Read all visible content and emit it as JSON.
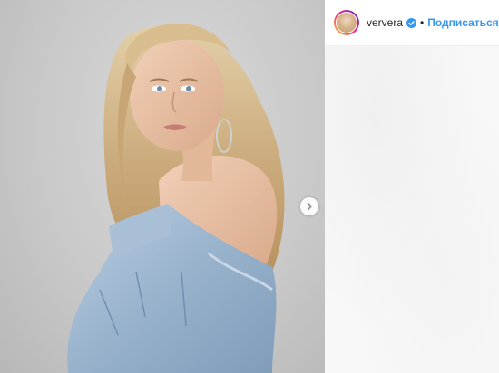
{
  "post": {
    "photo_alt": "Portrait photo",
    "next_icon": "chevron-right-icon"
  },
  "header": {
    "username": "ververa",
    "verified_icon": "verified-badge-icon",
    "separator": "•",
    "follow_label": "Подписаться"
  },
  "colors": {
    "follow": "#3897f0",
    "verified": "#3897f0",
    "panel_bg": "#fafafa"
  }
}
